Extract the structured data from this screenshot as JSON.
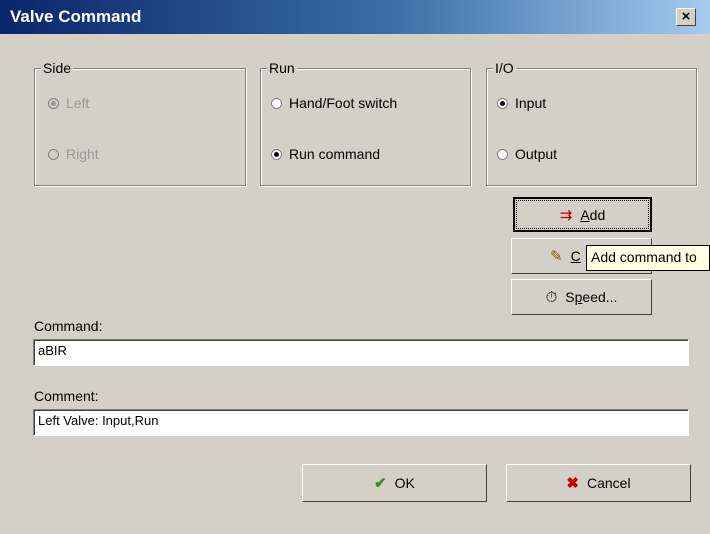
{
  "window": {
    "title": "Valve Command",
    "close_label": "×"
  },
  "groups": {
    "side": {
      "label": "Side",
      "options": [
        "Left",
        "Right"
      ],
      "selected": "Left"
    },
    "run": {
      "label": "Run",
      "options": [
        "Hand/Foot switch",
        "Run command"
      ],
      "selected": "Run command"
    },
    "io": {
      "label": "I/O",
      "options": [
        "Input",
        "Output"
      ],
      "selected": "Input"
    }
  },
  "buttons": {
    "add_prefix": "",
    "add_mnemonic": "A",
    "add_rest": "dd",
    "clear_mnemonic": "C",
    "speed_prefix": "S",
    "speed_mnemonic": "p",
    "speed_rest": "eed...",
    "ok": "OK",
    "cancel": "Cancel"
  },
  "tooltip": "Add command to",
  "command": {
    "label": "Command:",
    "value": "aBIR"
  },
  "comment": {
    "label": "Comment:",
    "value": "Left Valve: Input,Run"
  }
}
